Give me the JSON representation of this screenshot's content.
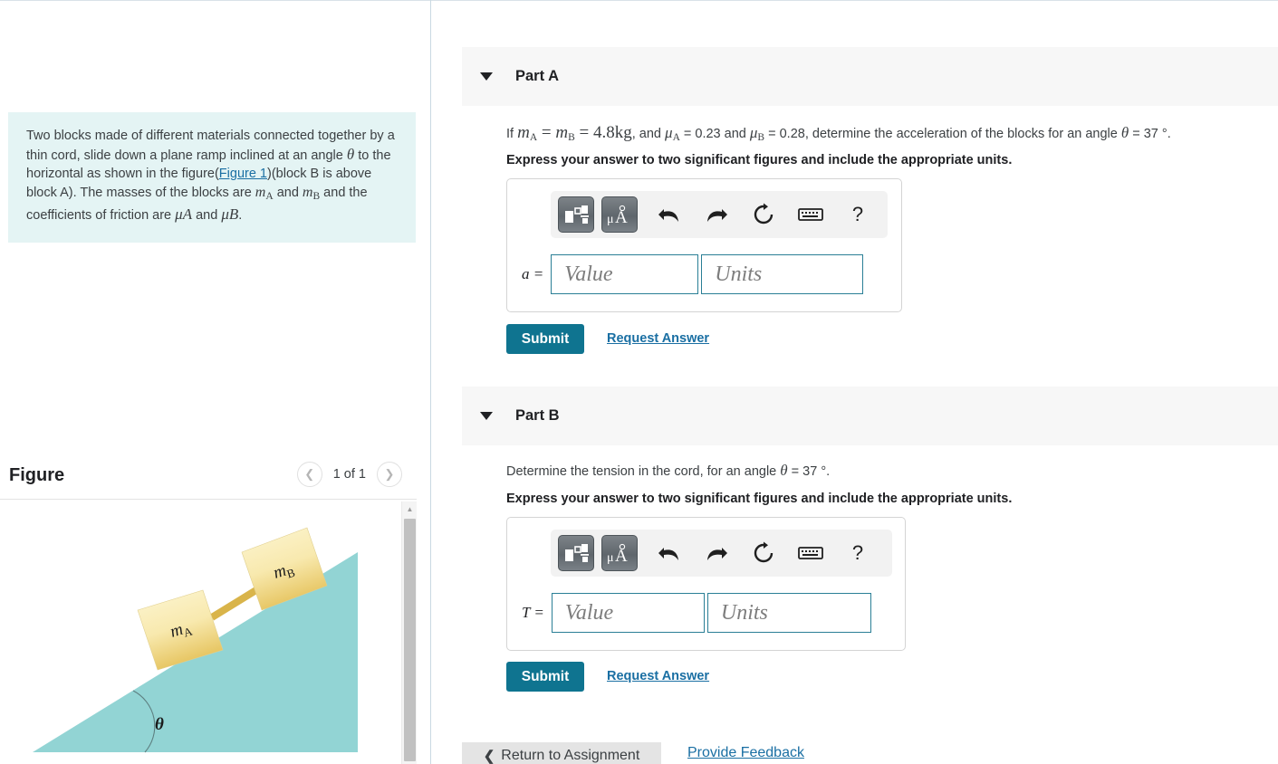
{
  "problem": {
    "text_part1": "Two blocks made of different materials connected together by a thin cord, slide down a plane ramp inclined at an angle ",
    "theta": "θ",
    "text_part2": " to the horizontal as shown in the figure(",
    "figure_link": "Figure 1",
    "text_part3": ")(block B is above block A). The masses of the blocks are ",
    "mA": "m",
    "subA": "A",
    "text_and1": " and ",
    "mB": "m",
    "subB": "B",
    "text_part4": " and the coefficients of friction are ",
    "muA": "μ",
    "text_and2": " and ",
    "muB": "μ",
    "period": "."
  },
  "figure": {
    "title": "Figure",
    "page_count": "1 of 1",
    "prev_icon": "chevron-left-icon",
    "next_icon": "chevron-right-icon",
    "labels": {
      "block_a": "m",
      "block_a_sub": "A",
      "block_b": "m",
      "block_b_sub": "B",
      "angle": "θ"
    },
    "colors": {
      "ramp": "#92d4d4",
      "block_light": "#fdf5cf",
      "block_dark": "#e8c870",
      "cord": "#d9b44a"
    },
    "scroll_up_icon": "triangle-up-icon"
  },
  "parts": [
    {
      "id": "a",
      "title": "Part A",
      "caret_icon": "caret-down-icon",
      "question": {
        "prefix": "If ",
        "m1": "m",
        "m1_sub": "A",
        "eq1": " = ",
        "m2": "m",
        "m2_sub": "B",
        "eq2": " = ",
        "mass_value": "4.8kg",
        "mid": ", and ",
        "mu1": "μ",
        "mu1_sub": "A",
        "mu1_eq": " = 0.23 and ",
        "mu2": "μ",
        "mu2_sub": "B",
        "mu2_eq": " = 0.28, determine the acceleration of the blocks for an angle ",
        "theta": "θ",
        "angle_eq": " = 37 ",
        "degree": "°",
        "end": "."
      },
      "instruction": "Express your answer to two significant figures and include the appropriate units.",
      "answer": {
        "variable": "a =",
        "value_placeholder": "Value",
        "units_placeholder": "Units"
      },
      "toolbar": {
        "template_icon": "math-template-icon",
        "unit_icon": "micro-angstrom-unit-icon",
        "undo_icon": "undo-arrow-icon",
        "redo_icon": "redo-arrow-icon",
        "reset_icon": "reset-circle-icon",
        "keyboard_icon": "keyboard-icon",
        "help_icon": "question-mark-icon",
        "help_label": "?"
      },
      "submit_label": "Submit",
      "request_label": "Request Answer"
    },
    {
      "id": "b",
      "title": "Part B",
      "caret_icon": "caret-down-icon",
      "question": {
        "prefix": "Determine the tension in the cord, for an angle ",
        "theta": "θ",
        "angle_eq": " = 37 ",
        "degree": "°",
        "end": "."
      },
      "instruction": "Express your answer to two significant figures and include the appropriate units.",
      "answer": {
        "variable": "T =",
        "value_placeholder": "Value",
        "units_placeholder": "Units"
      },
      "toolbar": {
        "template_icon": "math-template-icon",
        "unit_icon": "micro-angstrom-unit-icon",
        "undo_icon": "undo-arrow-icon",
        "redo_icon": "redo-arrow-icon",
        "reset_icon": "reset-circle-icon",
        "keyboard_icon": "keyboard-icon",
        "help_icon": "question-mark-icon",
        "help_label": "?"
      },
      "submit_label": "Submit",
      "request_label": "Request Answer"
    }
  ],
  "footer": {
    "return_label": "Return to Assignment",
    "return_chevron": "❮",
    "feedback_label": "Provide Feedback"
  },
  "colors": {
    "accent": "#0f7490",
    "link": "#1a6fa3",
    "problem_bg": "#e4f4f4",
    "part_header_bg": "#f7f7f7",
    "input_border": "#2a7f96"
  }
}
